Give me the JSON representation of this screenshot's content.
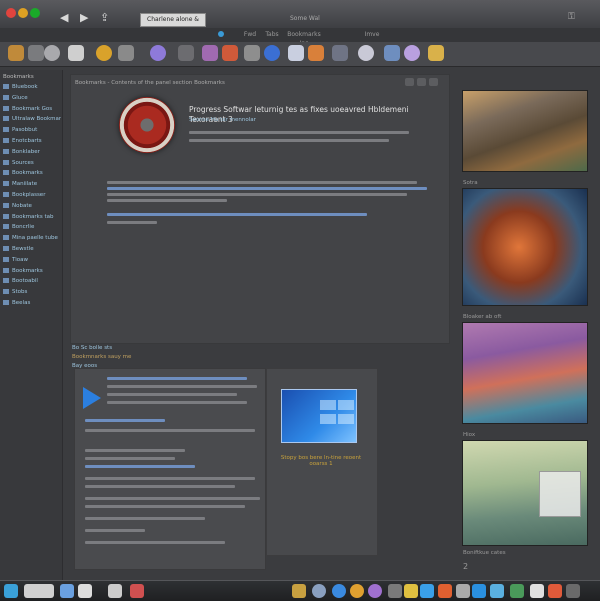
{
  "window": {
    "address": "Charlene alone & tech",
    "center_title": "Some Wal",
    "right_title": "Tipe"
  },
  "tabs": [
    "Fwd",
    "Tabs",
    "Bookmarks Ins",
    "Imve"
  ],
  "sidebar": {
    "header": "Bookmarks",
    "items": [
      "Bluebook",
      "Gluce",
      "Bookmark Gos",
      "Ultralaw Bookmarks",
      "Pasobbut",
      "Enotcbarts",
      "Bonklaber",
      "Sources",
      "Bookmarks",
      "Maniilate",
      "Bookplasser",
      "Nobate",
      "Bookmarks tab",
      "Boncrlie",
      "Mina paelle tube",
      "Bewstle",
      "Tioaw",
      "Bookmarks",
      "Bootoabil",
      "Stobs",
      "Beelas"
    ]
  },
  "article": {
    "head": "Bookmarks - Contents of the panel section Bookmarks",
    "title": "Progress Softwar leturnig tes as fixes uoeavred Hbldemeni Texoraent 3",
    "subtitle": "Seonse Hu tar mennolar"
  },
  "lower": {
    "label1": "Bo Sc bolle sts",
    "label2": "Bookmnarks sauy me",
    "label3": "Bay eoos"
  },
  "win_note": "Stopy bos bere ln-tine reoent ooarss 1",
  "thumbs": [
    {
      "caption": ""
    },
    {
      "caption": "Sotra"
    },
    {
      "caption": "Bloaker ab oft"
    },
    {
      "caption": "Hiox"
    },
    {
      "caption": "Boniftkue cates"
    }
  ],
  "final_caption": "2"
}
